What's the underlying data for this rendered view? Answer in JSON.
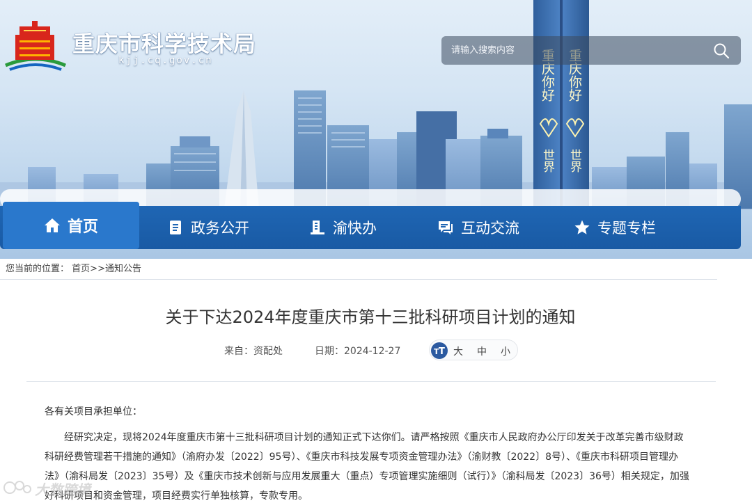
{
  "header": {
    "site_title": "重庆市科学技术局",
    "site_domain": "kjj.cq.gov.cn",
    "search_placeholder": "请输入搜索内容",
    "tower_left_text": "重庆你好",
    "tower_right_text": "重庆你好",
    "tower_world_text": "世界"
  },
  "nav": {
    "items": [
      {
        "label": "首页",
        "icon": "home-icon"
      },
      {
        "label": "政务公开",
        "icon": "document-icon"
      },
      {
        "label": "渝快办",
        "icon": "building-icon"
      },
      {
        "label": "互动交流",
        "icon": "chat-icon"
      },
      {
        "label": "专题专栏",
        "icon": "star-icon"
      }
    ]
  },
  "breadcrumb": {
    "prefix": "您当前的位置：",
    "home": "首页",
    "sep": ">>",
    "current": "通知公告"
  },
  "article": {
    "title": "关于下达2024年度重庆市第十三批科研项目计划的通知",
    "source_label": "来自：资配处",
    "date_label": "日期：2024-12-27",
    "font_sizes": [
      "大",
      "中",
      "小"
    ],
    "salutation": "各有关项目承担单位：",
    "paragraph": "经研究决定，现将2024年度重庆市第十三批科研项目计划的通知正式下达你们。请严格按照《重庆市人民政府办公厅印发关于改革完善市级财政科研经费管理若干措施的通知》（渝府办发〔2022〕95号）、《重庆市科技发展专项资金管理办法》（渝财教〔2022〕8号）、《重庆市科研项目管理办法》（渝科局发〔2023〕35号）及《重庆市技术创新与应用发展重大（重点）专项管理实施细则（试行）》（渝科局发〔2023〕36号）相关规定，加强好科研项目和资金管理，项目经费实行单独核算，专款专用。"
  },
  "watermark": {
    "text": "大数跨境"
  },
  "colors": {
    "nav_bg": "#1f66b4",
    "nav_active": "#2a78cc",
    "logo_red": "#d8261c",
    "logo_green": "#2a9a3c",
    "logo_blue": "#1565c0"
  }
}
